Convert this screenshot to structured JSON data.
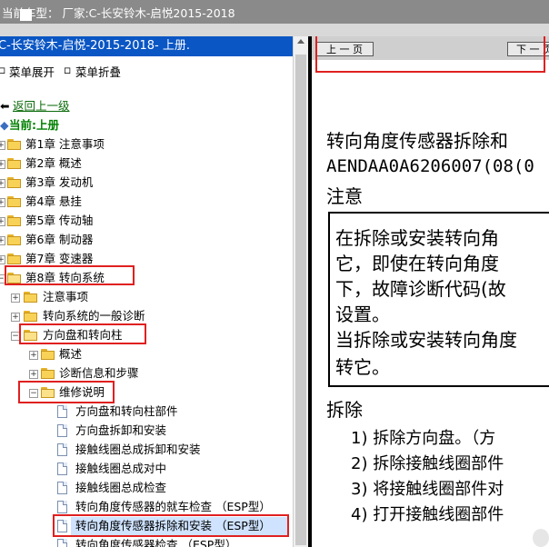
{
  "window": {
    "title": "当前车型：  厂家:C-长安铃木-启悦2015-2018"
  },
  "left_panel": {
    "header": "C-长安铃木-启悦-2015-2018- 上册.",
    "menu": {
      "expand_all": "菜单展开",
      "collapse_all": "菜单折叠"
    },
    "back_link": "返回上一级",
    "current": "当前:上册",
    "chapters": [
      "第1章 注意事项",
      "第2章 概述",
      "第3章 发动机",
      "第4章 悬挂",
      "第5章 传动轴",
      "第6章 制动器",
      "第7章 变速器",
      "第8章 转向系统"
    ],
    "chapter8_children": [
      "注意事项",
      "转向系统的一般诊断",
      "方向盘和转向柱"
    ],
    "steering_children": [
      "概述",
      "诊断信息和步骤",
      "维修说明"
    ],
    "repair_items": [
      "方向盘和转向柱部件",
      "方向盘拆卸和安装",
      "接触线圈总成拆卸和安装",
      "接触线圈总成对中",
      "接触线圈总成检查",
      "转向角度传感器的就车检查 （ESP型）",
      "转向角度传感器拆除和安装 （ESP型）",
      "转向角度传感器检查 （ESP型）"
    ]
  },
  "right_panel": {
    "prev_button": "上 一 页",
    "next_button": "下 一 页",
    "title_line": "转向角度传感器拆除和",
    "code_line": "AENDAA0A6206007(08(0",
    "caution_heading": "注意",
    "caution_lines": [
      "在拆除或安装转向角",
      "它，即使在转向角度",
      "下，故障诊断代码(故",
      "设置。",
      "当拆除或安装转向角度",
      "转它。"
    ],
    "removal_heading": "拆除",
    "steps": [
      "1)  拆除方向盘。（方",
      "2)  拆除接触线圈部件",
      "3)  将接触线圈部件对",
      "4)  打开接触线圈部件"
    ]
  },
  "colors": {
    "header_blue": "#0a56c4",
    "highlight_red": "#e02020",
    "link_green": "#0a6a0a"
  }
}
